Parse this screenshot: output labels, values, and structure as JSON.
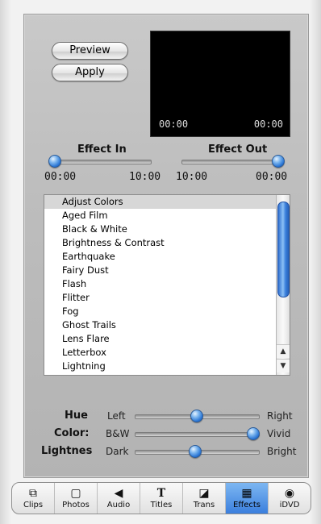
{
  "buttons": {
    "preview": "Preview",
    "apply": "Apply"
  },
  "preview_screen": {
    "time_left": "00:00",
    "time_right": "00:00"
  },
  "effect_in": {
    "label": "Effect In",
    "time_start": "00:00",
    "time_end": "10:00"
  },
  "effect_out": {
    "label": "Effect Out",
    "time_start": "10:00",
    "time_end": "00:00"
  },
  "effects_list": {
    "items": [
      "Adjust Colors",
      "Aged Film",
      "Black & White",
      "Brightness & Contrast",
      "Earthquake",
      "Fairy Dust",
      "Flash",
      "Flitter",
      "Fog",
      "Ghost Trails",
      "Lens Flare",
      "Letterbox",
      "Lightning"
    ],
    "selected_index": 0
  },
  "adjustments": {
    "hue": {
      "label": "Hue",
      "left": "Left",
      "right": "Right",
      "value": 0.5
    },
    "color": {
      "label": "Color:",
      "left": "B&W",
      "right": "Vivid",
      "value": 1.0
    },
    "lightness": {
      "label": "Lightnes",
      "left": "Dark",
      "right": "Bright",
      "value": 0.5
    }
  },
  "tabs": [
    {
      "label": "Clips",
      "icon": "clips-icon",
      "glyph": "⧉"
    },
    {
      "label": "Photos",
      "icon": "photos-icon",
      "glyph": "▢"
    },
    {
      "label": "Audio",
      "icon": "speaker-icon",
      "glyph": "◀"
    },
    {
      "label": "Titles",
      "icon": "titles-icon",
      "glyph": "T"
    },
    {
      "label": "Trans",
      "icon": "transitions-icon",
      "glyph": "◪"
    },
    {
      "label": "Effects",
      "icon": "effects-icon",
      "glyph": "▦",
      "active": true
    },
    {
      "label": "iDVD",
      "icon": "idvd-icon",
      "glyph": "◉"
    }
  ],
  "colors": {
    "accent": "#3b7fdd",
    "panel": "#bdbdbd",
    "knob": "#2a75d4"
  }
}
